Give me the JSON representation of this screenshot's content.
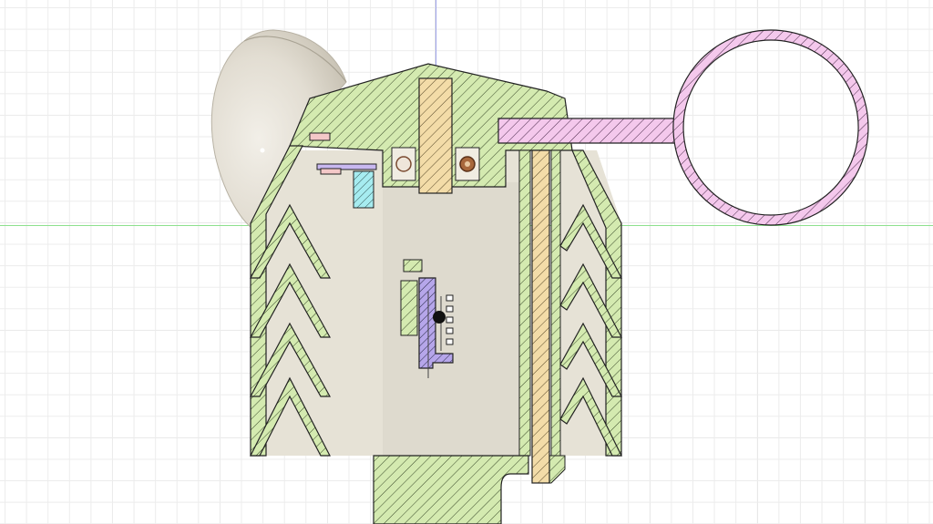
{
  "viewport": {
    "tool": "section-analysis",
    "view": "front"
  },
  "colors": {
    "body_hatch": "#d4eab0",
    "housing_fill": "#e6e2d6",
    "shaft_hatch": "#f3dca8",
    "arm_hatch": "#f4c8ec",
    "cyan_part": "#a6ecf0",
    "purple_part": "#b6a6ea",
    "dome": "#e2ddd2",
    "axis_vertical": "#9aa0e8",
    "axis_horizontal": "#8ee08e"
  },
  "parts": [
    {
      "name": "cup-dome",
      "color": "dome"
    },
    {
      "name": "housing-body",
      "color": "body_hatch"
    },
    {
      "name": "central-shaft",
      "color": "shaft_hatch"
    },
    {
      "name": "wind-vane-arm",
      "color": "arm_hatch"
    },
    {
      "name": "threaded-rod",
      "color": "shaft_hatch"
    },
    {
      "name": "sensor-module",
      "color": "cyan_part"
    },
    {
      "name": "circuit-board",
      "color": "purple_part"
    }
  ]
}
